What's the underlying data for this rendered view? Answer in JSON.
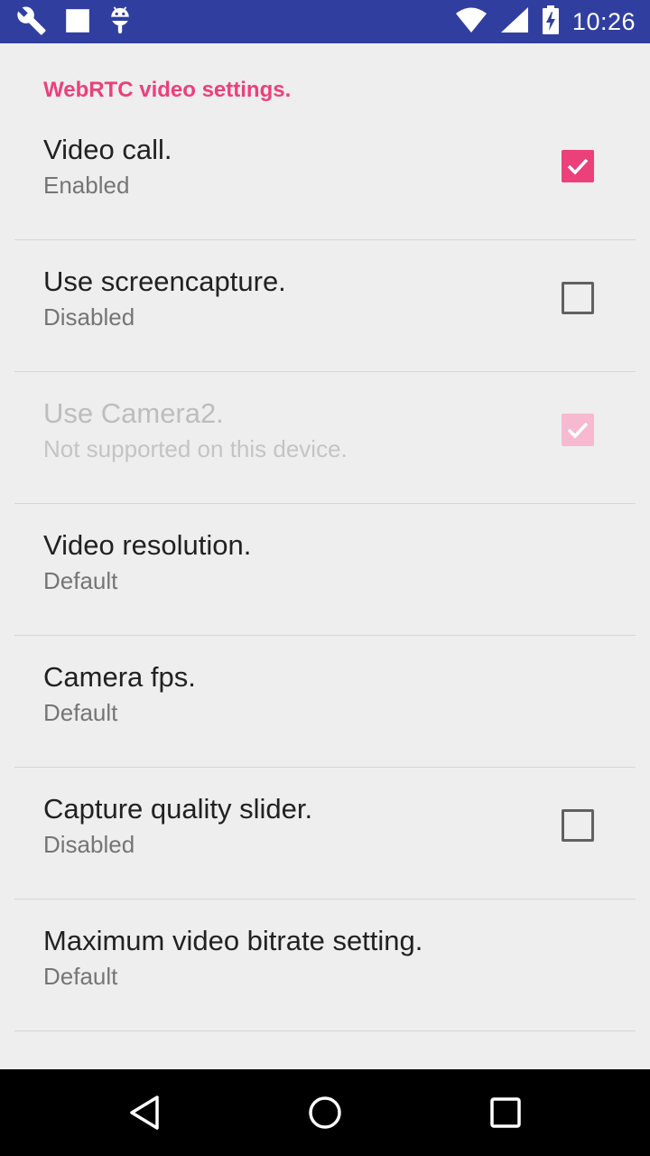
{
  "status_bar": {
    "time": "10:26",
    "left_icons": [
      "wrench-icon",
      "stop-square-icon",
      "android-debug-icon"
    ],
    "right_icons": [
      "wifi-icon",
      "cell-signal-icon",
      "battery-charging-icon"
    ],
    "background": "#303f9f"
  },
  "settings": {
    "section_title": "WebRTC video settings.",
    "accent": "#ec407a",
    "items": [
      {
        "title": "Video call.",
        "summary": "Enabled",
        "checkbox": "checked",
        "enabled": true
      },
      {
        "title": "Use screencapture.",
        "summary": "Disabled",
        "checkbox": "unchecked",
        "enabled": true
      },
      {
        "title": "Use Camera2.",
        "summary": "Not supported on this device.",
        "checkbox": "checked",
        "enabled": false
      },
      {
        "title": "Video resolution.",
        "summary": "Default",
        "checkbox": "none",
        "enabled": true
      },
      {
        "title": "Camera fps.",
        "summary": "Default",
        "checkbox": "none",
        "enabled": true
      },
      {
        "title": "Capture quality slider.",
        "summary": "Disabled",
        "checkbox": "unchecked",
        "enabled": true
      },
      {
        "title": "Maximum video bitrate setting.",
        "summary": "Default",
        "checkbox": "none",
        "enabled": true
      }
    ]
  },
  "nav_bar": {
    "buttons": [
      "back-icon",
      "home-icon",
      "recents-icon"
    ]
  }
}
